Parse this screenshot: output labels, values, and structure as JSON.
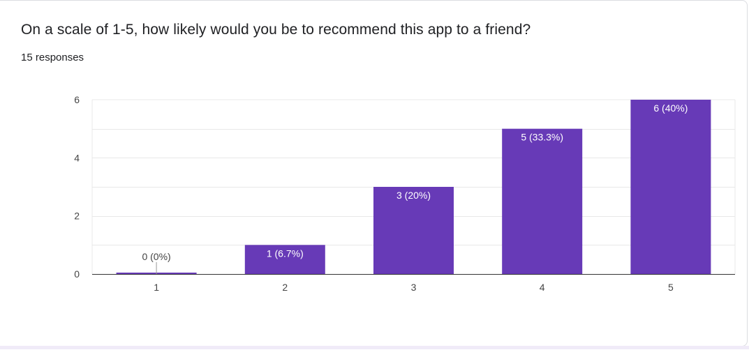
{
  "question": {
    "title": "On a scale of 1-5, how likely would you be to recommend this app to a friend?",
    "responses_label": "15 responses"
  },
  "colors": {
    "bar": "#673ab7",
    "gridline": "#e8e8e8",
    "axis": "#333333",
    "label_inside": "#ffffff",
    "label_outside": "#444444"
  },
  "chart_data": {
    "type": "bar",
    "categories": [
      "1",
      "2",
      "3",
      "4",
      "5"
    ],
    "values": [
      0,
      1,
      3,
      5,
      6
    ],
    "data_labels": [
      "0 (0%)",
      "1 (6.7%)",
      "3 (20%)",
      "5 (33.3%)",
      "6 (40%)"
    ],
    "y_ticks": [
      "0",
      "2",
      "4",
      "6"
    ],
    "ylim": [
      0,
      6
    ],
    "grid": true,
    "title": "",
    "xlabel": "",
    "ylabel": ""
  }
}
